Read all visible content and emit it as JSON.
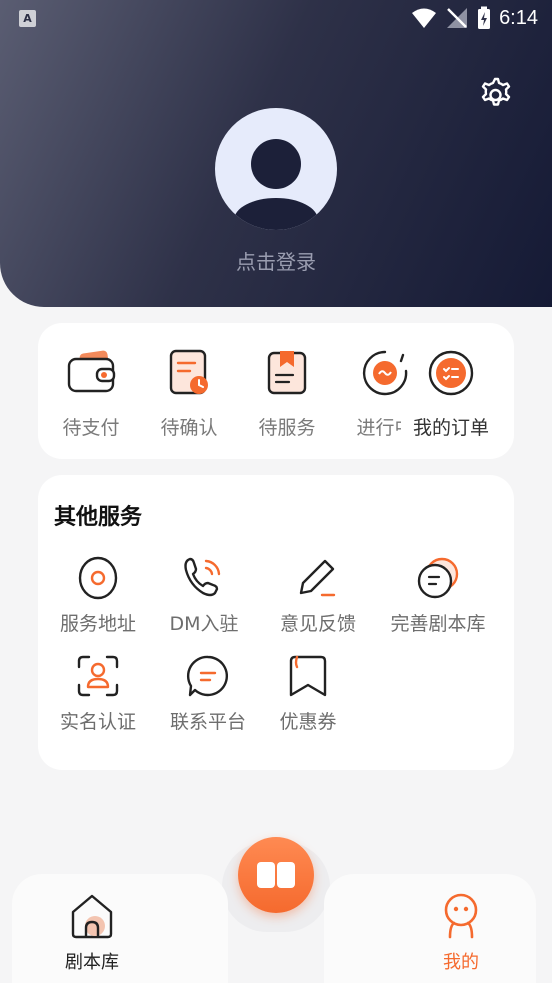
{
  "status_bar": {
    "time": "6:14",
    "app_badge": "A"
  },
  "header": {
    "login_text": "点击登录"
  },
  "orders": [
    {
      "label": "待支付",
      "icon": "wallet-icon"
    },
    {
      "label": "待确认",
      "icon": "clock-document-icon"
    },
    {
      "label": "待服务",
      "icon": "bookmark-clipboard-icon"
    },
    {
      "label": "进行中",
      "icon": "in-progress-icon"
    },
    {
      "label": "我的订单",
      "icon": "order-list-icon"
    }
  ],
  "services": {
    "title": "其他服务",
    "items": [
      {
        "label": "服务地址",
        "icon": "location-icon"
      },
      {
        "label": "DM入驻",
        "icon": "phone-icon"
      },
      {
        "label": "意见反馈",
        "icon": "pencil-icon"
      },
      {
        "label": "完善剧本库",
        "icon": "chat-stack-icon"
      },
      {
        "label": "实名认证",
        "icon": "face-scan-icon"
      },
      {
        "label": "联系平台",
        "icon": "message-icon"
      },
      {
        "label": "优惠券",
        "icon": "coupon-icon"
      }
    ]
  },
  "bottom_nav": {
    "left": {
      "label": "剧本库",
      "icon": "home-icon"
    },
    "right": {
      "label": "我的",
      "icon": "profile-icon"
    }
  },
  "colors": {
    "accent": "#f56a2e",
    "header_dark": "#151a35",
    "text_gray": "#7a7a7a"
  }
}
